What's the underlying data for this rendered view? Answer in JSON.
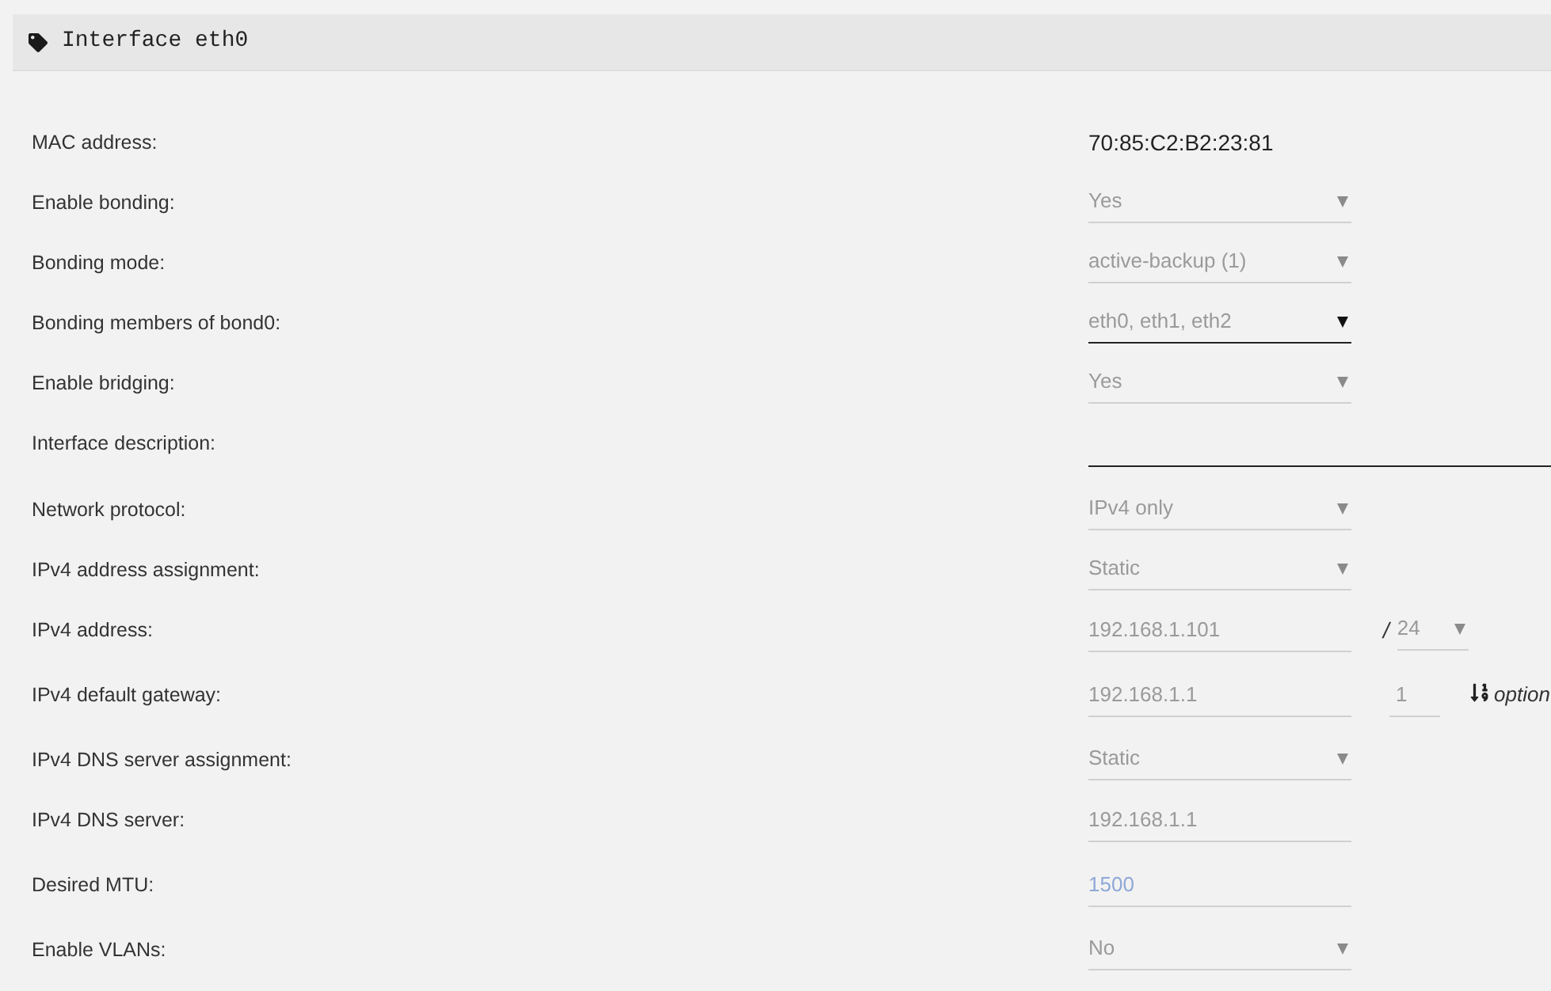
{
  "header": {
    "title": "Interface eth0"
  },
  "fields": [
    {
      "label": "MAC address:",
      "kind": "text",
      "value": "70:85:C2:B2:23:81"
    },
    {
      "label": "Enable bonding:",
      "kind": "select",
      "value": "Yes",
      "disabled": true
    },
    {
      "label": "Bonding mode:",
      "kind": "select",
      "value": "active-backup (1)",
      "disabled": true
    },
    {
      "label": "Bonding members of bond0:",
      "kind": "select",
      "value": "eth0, eth1, eth2",
      "disabled": false
    },
    {
      "label": "Enable bridging:",
      "kind": "select",
      "value": "Yes",
      "disabled": true
    },
    {
      "label": "Interface description:",
      "kind": "wide",
      "disabled": false
    },
    {
      "label": "Network protocol:",
      "kind": "select",
      "value": "IPv4 only",
      "disabled": true
    },
    {
      "label": "IPv4 address assignment:",
      "kind": "select",
      "value": "Static",
      "disabled": true
    },
    {
      "label": "IPv4 address:",
      "kind": "input",
      "value": "192.168.1.101",
      "disabled": true,
      "suffix": {
        "kind": "netmask",
        "separator": "/",
        "value": "24",
        "disabled": true
      }
    },
    {
      "label": "IPv4 default gateway:",
      "kind": "input",
      "value": "192.168.1.1",
      "disabled": true,
      "suffix": {
        "kind": "metric",
        "value": "1",
        "note": "option",
        "disabled": true
      }
    },
    {
      "label": "IPv4 DNS server assignment:",
      "kind": "select",
      "value": "Static",
      "disabled": true
    },
    {
      "label": "IPv4 DNS server:",
      "kind": "input",
      "value": "192.168.1.1",
      "disabled": true
    },
    {
      "label": "Desired MTU:",
      "kind": "input",
      "placeholder": "1500",
      "disabled": true
    },
    {
      "label": "Enable VLANs:",
      "kind": "select",
      "value": "No",
      "disabled": true
    }
  ]
}
